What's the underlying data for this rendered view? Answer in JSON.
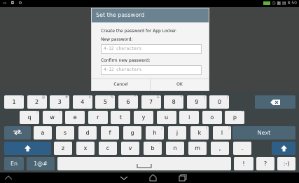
{
  "statusbar": {
    "left_icons": "▭ ◘ ⚙",
    "right_icons": "◷ ▦ ▤ 8:50"
  },
  "dialog": {
    "title": "Set the password",
    "message": "Create the password for App Locker.",
    "new_label": "New password:",
    "new_placeholder": "4-12 characters",
    "confirm_label": "Confirm new password:",
    "confirm_placeholder": "4-12 characters",
    "cancel": "Cancel",
    "ok": "OK"
  },
  "keyboard": {
    "row1": [
      {
        "label": "1",
        "sup": "!"
      },
      {
        "label": "2",
        "sup": "@"
      },
      {
        "label": "3",
        "sup": "#"
      },
      {
        "label": "4",
        "sup": "$"
      },
      {
        "label": "5",
        "sup": "%"
      },
      {
        "label": "6",
        "sup": "^"
      },
      {
        "label": "7",
        "sup": "&"
      },
      {
        "label": "8",
        "sup": "*"
      },
      {
        "label": "9",
        "sup": "("
      },
      {
        "label": "0",
        "sup": ")"
      }
    ],
    "row2": [
      {
        "label": "q",
        "sup": "!"
      },
      {
        "label": "w",
        "sup": "!"
      },
      {
        "label": "e",
        "sup": ""
      },
      {
        "label": "r",
        "sup": ""
      },
      {
        "label": "t",
        "sup": ""
      },
      {
        "label": "y",
        "sup": ""
      },
      {
        "label": "u",
        "sup": ""
      },
      {
        "label": "i",
        "sup": ""
      },
      {
        "label": "o",
        "sup": ""
      },
      {
        "label": "p",
        "sup": "\""
      }
    ],
    "row3": [
      {
        "label": "a",
        "sup": ""
      },
      {
        "label": "s",
        "sup": ""
      },
      {
        "label": "d",
        "sup": ""
      },
      {
        "label": "f",
        "sup": ""
      },
      {
        "label": "g",
        "sup": ""
      },
      {
        "label": "h",
        "sup": "/"
      },
      {
        "label": "j",
        "sup": ""
      },
      {
        "label": "k",
        "sup": "("
      },
      {
        "label": "l",
        "sup": ")"
      }
    ],
    "row4": [
      {
        "label": "z",
        "sup": ""
      },
      {
        "label": "x",
        "sup": ""
      },
      {
        "label": "c",
        "sup": ""
      },
      {
        "label": "v",
        "sup": ""
      },
      {
        "label": "b",
        "sup": "-"
      },
      {
        "label": "n",
        "sup": ""
      },
      {
        "label": "m",
        "sup": "'"
      },
      {
        "label": ",",
        "sup": ""
      },
      {
        "label": ".",
        "sup": ""
      }
    ],
    "next_label": "Next",
    "lang_label": "En",
    "symbols_label": "1@#",
    "exclaim_label": "!",
    "question_label": "?",
    "smiley_label": ":-)"
  },
  "colors": {
    "title_bar": "#6b8391",
    "keyboard_bg": "#3e4547",
    "function_key": "#4c6676"
  }
}
